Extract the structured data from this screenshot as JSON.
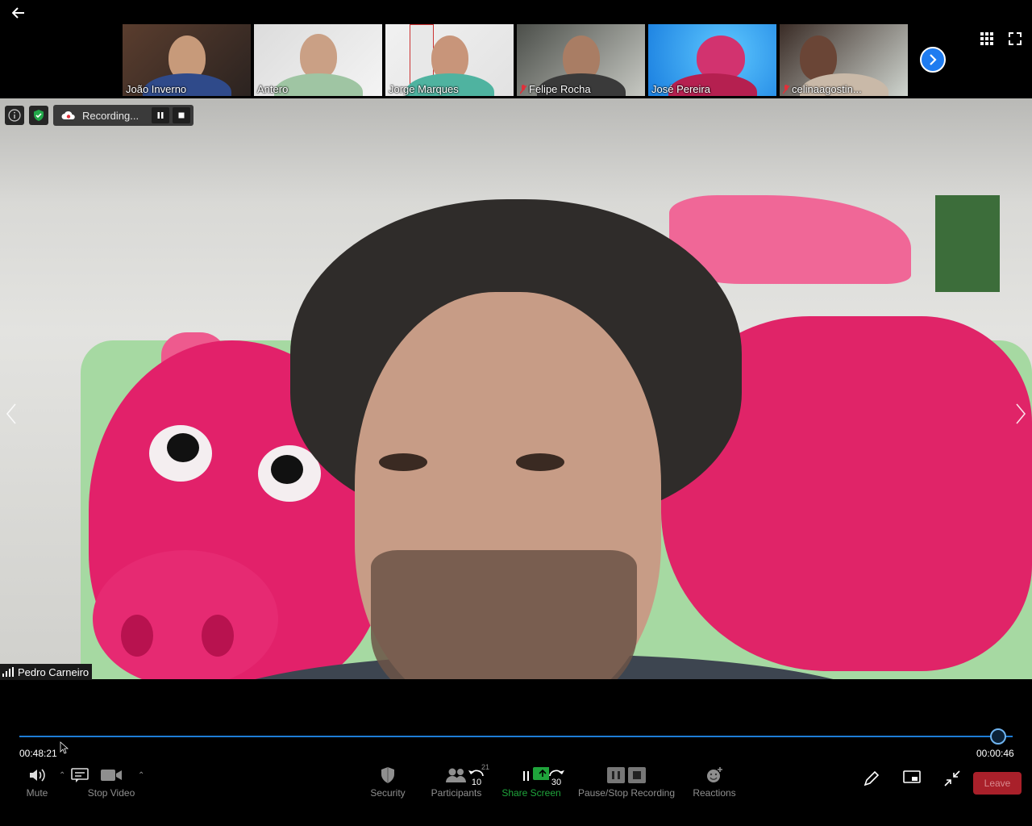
{
  "meeting": {
    "participants_thumbs": [
      {
        "name": "João Inverno",
        "muted": false
      },
      {
        "name": "Antero",
        "muted": false
      },
      {
        "name": "Jorge Marques",
        "muted": false
      },
      {
        "name": "Felipe Rocha",
        "muted": true
      },
      {
        "name": "José Pereira",
        "muted": false
      },
      {
        "name": "celinaagostin...",
        "muted": true
      }
    ],
    "active_speaker": "Pedro Carneiro"
  },
  "recording": {
    "status": "Recording..."
  },
  "player": {
    "elapsed": "00:48:21",
    "remaining": "00:00:46",
    "progress": 0.985
  },
  "toolbar": {
    "mute_label": "Mute",
    "stop_video_label": "Stop Video",
    "security_label": "Security",
    "participants_label": "Participants",
    "participants_count": "21",
    "share_screen_label": "Share Screen",
    "pause_stop_label": "Pause/Stop Recording",
    "reactions_label": "Reactions",
    "leave_label": "Leave",
    "rewind_seconds": "10",
    "forward_seconds": "30"
  },
  "colors": {
    "accent_blue": "#1e7cd6",
    "leave_red": "#a9202a",
    "share_green": "#1fa43b",
    "shield_green": "#22a84a"
  }
}
